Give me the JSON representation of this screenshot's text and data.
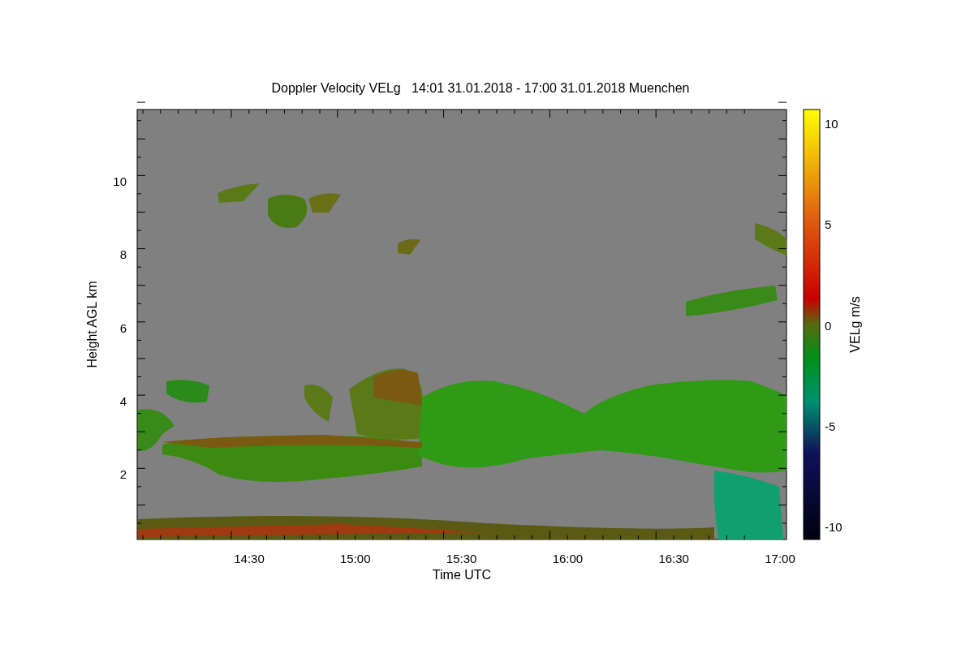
{
  "title": "Doppler Velocity VELg   14:01 31.01.2018 - 17:00 31.01.2018 Muenchen",
  "y_axis": {
    "label": "Height AGL km",
    "ticks": [
      "10",
      "8",
      "6",
      "4",
      "2"
    ]
  },
  "x_axis": {
    "label": "Time UTC",
    "ticks": [
      "14:30",
      "15:00",
      "15:30",
      "16:00",
      "16:30",
      "17:00"
    ]
  },
  "colorbar": {
    "label": "VELg m/s",
    "ticks": [
      "10",
      "5",
      "0",
      "-5",
      "-10"
    ]
  }
}
